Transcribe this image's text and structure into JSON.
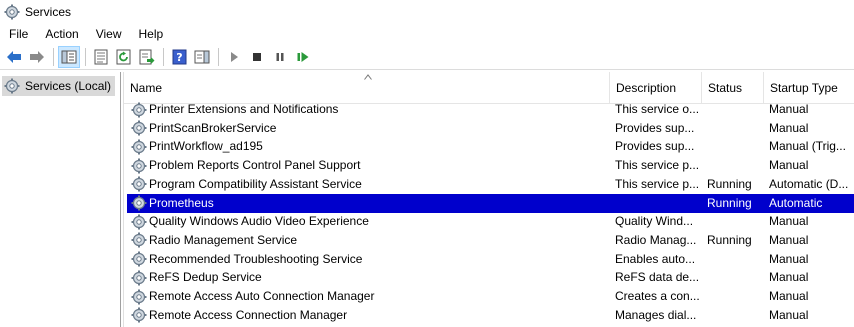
{
  "window": {
    "title": "Services"
  },
  "menu": [
    "File",
    "Action",
    "View",
    "Help"
  ],
  "tree": {
    "item": "Services (Local)"
  },
  "columns": {
    "name": "Name",
    "description": "Description",
    "status": "Status",
    "startup": "Startup Type"
  },
  "selected_color": "#0000cc",
  "services": [
    {
      "name": "Printer Extensions and Notifications",
      "description": "This service o...",
      "status": "",
      "startup": "Manual"
    },
    {
      "name": "PrintScanBrokerService",
      "description": "Provides sup...",
      "status": "",
      "startup": "Manual"
    },
    {
      "name": "PrintWorkflow_ad195",
      "description": "Provides sup...",
      "status": "",
      "startup": "Manual (Trig..."
    },
    {
      "name": "Problem Reports Control Panel Support",
      "description": "This service p...",
      "status": "",
      "startup": "Manual"
    },
    {
      "name": "Program Compatibility Assistant Service",
      "description": "This service p...",
      "status": "Running",
      "startup": "Automatic (D..."
    },
    {
      "name": "Prometheus",
      "description": "",
      "status": "Running",
      "startup": "Automatic",
      "selected": true
    },
    {
      "name": "Quality Windows Audio Video Experience",
      "description": "Quality Wind...",
      "status": "",
      "startup": "Manual"
    },
    {
      "name": "Radio Management Service",
      "description": "Radio Manag...",
      "status": "Running",
      "startup": "Manual"
    },
    {
      "name": "Recommended Troubleshooting Service",
      "description": "Enables auto...",
      "status": "",
      "startup": "Manual"
    },
    {
      "name": "ReFS Dedup Service",
      "description": "ReFS data de...",
      "status": "",
      "startup": "Manual"
    },
    {
      "name": "Remote Access Auto Connection Manager",
      "description": "Creates a con...",
      "status": "",
      "startup": "Manual"
    },
    {
      "name": "Remote Access Connection Manager",
      "description": "Manages dial...",
      "status": "",
      "startup": "Manual"
    }
  ]
}
